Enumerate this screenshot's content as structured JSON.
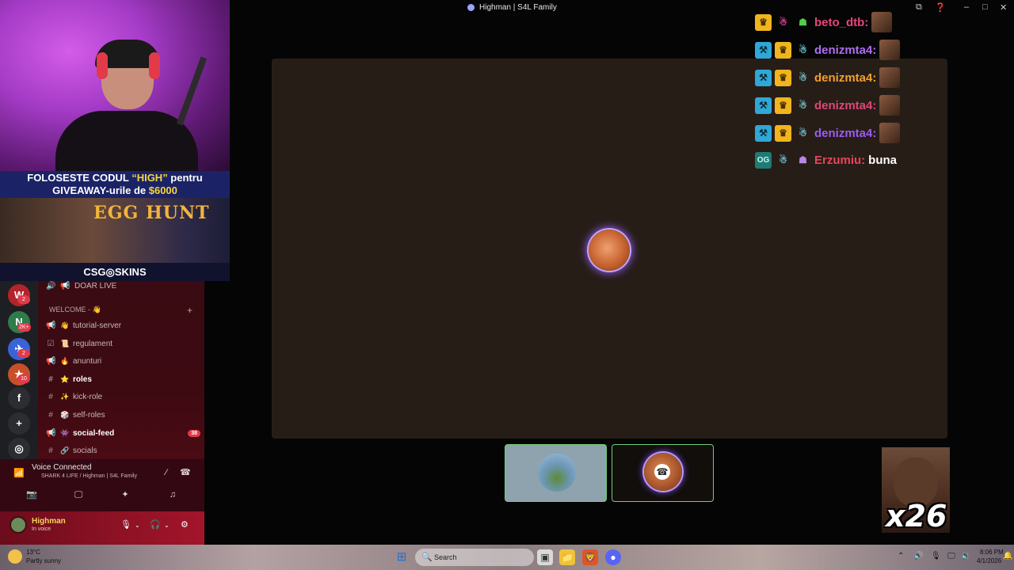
{
  "window": {
    "title": "Highman | S4L Family"
  },
  "webcam": {
    "banner_line1_a": "FOLOSESTE CODUL ",
    "banner_code": "“HIGH”",
    "banner_line1_b": " pentru",
    "banner_line2_a": "GIVEAWAY-urile de ",
    "banner_amount": "$6000",
    "promo_title": "EGG HUNT",
    "brand": "CSG◎SKINS"
  },
  "guilds": [
    {
      "letter": "W",
      "badge": "2"
    },
    {
      "letter": "N",
      "badge": "2K+"
    },
    {
      "letter": "✈",
      "badge": "2"
    },
    {
      "letter": "★",
      "badge": "10"
    },
    {
      "letter": "f",
      "badge": ""
    },
    {
      "letter": "+",
      "badge": ""
    },
    {
      "letter": "◎",
      "badge": ""
    }
  ],
  "channels": {
    "top_item": "DOAR LIVE",
    "category": "WELCOME - 👋",
    "items": [
      {
        "icon": "📢",
        "emoji": "👋",
        "label": "tutorial-server",
        "bold": false,
        "badge": ""
      },
      {
        "icon": "☑",
        "emoji": "📜",
        "label": "regulament",
        "bold": false,
        "badge": ""
      },
      {
        "icon": "📢",
        "emoji": "🔥",
        "label": "anunturi",
        "bold": false,
        "badge": ""
      },
      {
        "icon": "#",
        "emoji": "⭐",
        "label": "roles",
        "bold": true,
        "badge": ""
      },
      {
        "icon": "#",
        "emoji": "✨",
        "label": "kick-role",
        "bold": false,
        "badge": ""
      },
      {
        "icon": "#",
        "emoji": "🎲",
        "label": "self-roles",
        "bold": false,
        "badge": ""
      },
      {
        "icon": "📢",
        "emoji": "👾",
        "label": "social-feed",
        "bold": true,
        "badge": "38"
      },
      {
        "icon": "#",
        "emoji": "🔗",
        "label": "socials",
        "bold": false,
        "badge": ""
      }
    ]
  },
  "voice": {
    "status": "Voice Connected",
    "location": "SHARK 4 LIFE / Highman | S4L Family"
  },
  "user": {
    "name": "Highman",
    "status": "In voice"
  },
  "chat": [
    {
      "badges": [
        "crown",
        "pink",
        "green"
      ],
      "name": "beto_dtb:",
      "color": "#e8457a",
      "msg": "",
      "emote": true
    },
    {
      "badges": [
        "mod",
        "crown",
        "alien"
      ],
      "name": "denizmta4:",
      "color": "#b06cf0",
      "msg": "",
      "emote": true
    },
    {
      "badges": [
        "mod",
        "crown",
        "alien"
      ],
      "name": "denizmta4:",
      "color": "#f0a030",
      "msg": "",
      "emote": true
    },
    {
      "badges": [
        "mod",
        "crown",
        "alien"
      ],
      "name": "denizmta4:",
      "color": "#e0447a",
      "msg": "",
      "emote": true
    },
    {
      "badges": [
        "mod",
        "crown",
        "alien"
      ],
      "name": "denizmta4:",
      "color": "#9b5cf0",
      "msg": "",
      "emote": true
    },
    {
      "badges": [
        "og",
        "alien",
        "gift"
      ],
      "name": "Erzumiu:",
      "color": "#e8455a",
      "msg": "buna",
      "emote": false
    }
  ],
  "overlay": {
    "multiplier": "x26"
  },
  "taskbar": {
    "temp": "13°C",
    "weather": "Partly sunny",
    "search": "Search",
    "time": "8:06 PM",
    "date": "4/1/2026"
  },
  "colors": {
    "accent_red": "#e23a4a",
    "tile_border": "#6fcf76"
  }
}
